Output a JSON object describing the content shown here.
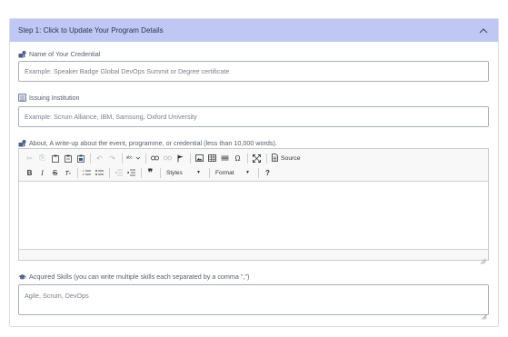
{
  "panel": {
    "title": "Step 1: Click to Update Your Program Details"
  },
  "fields": {
    "credential_name": {
      "label": "Name of Your Credential",
      "placeholder": "Example: Speaker Badge Global DevOps Summit or Degree certificate",
      "value": ""
    },
    "institution": {
      "label": "Issuing Institution",
      "placeholder": "Example: Scrum Alliance, IBM, Samsung, Oxford University",
      "value": ""
    },
    "about": {
      "label": "About, A write-up about the event, programme, or credential (less than 10,000 words).",
      "value": ""
    },
    "skills": {
      "label": "Acquired Skills (you can write multiple skills each separated by a comma \",\")",
      "placeholder": "Agile, Scrum, DevOps",
      "value": ""
    }
  },
  "editor": {
    "styles_label": "Styles",
    "format_label": "Format",
    "source_label": "Source",
    "help_label": "?"
  },
  "icons": {
    "collapse": "chevron-up-icon",
    "credential": "certificate-icon",
    "institution": "building-icon",
    "about": "certificate-icon",
    "skills": "graduation-cap-icon"
  },
  "colors": {
    "header_bg": "#bfc8f5",
    "border": "#a9aebd"
  }
}
